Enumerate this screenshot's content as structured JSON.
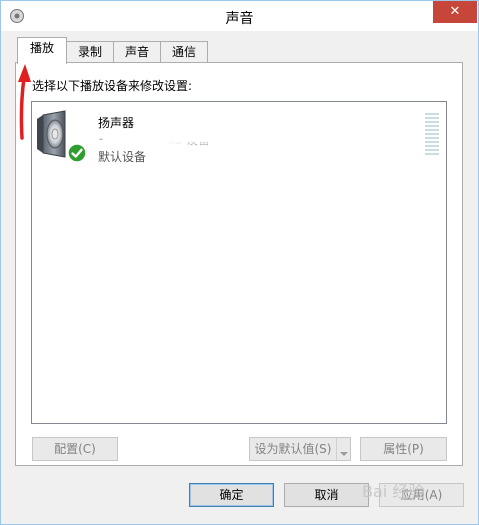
{
  "window": {
    "title": "声音",
    "close_glyph": "✕"
  },
  "tabs": [
    {
      "label": "播放",
      "active": true
    },
    {
      "label": "录制",
      "active": false
    },
    {
      "label": "声音",
      "active": false
    },
    {
      "label": "通信",
      "active": false
    }
  ],
  "playback": {
    "instruction": "选择以下播放设备来修改设置:",
    "devices": [
      {
        "name": "扬声器",
        "description_fragment_1": "⁃",
        "description_fragment_2": "lio",
        "description_fragment_3": "设备",
        "status": "默认设备",
        "icon": "speaker-icon",
        "badge": "green-check-icon"
      }
    ]
  },
  "buttons": {
    "configure": "配置(C)",
    "set_default": "设为默认值(S)",
    "properties": "属性(P)",
    "ok": "确定",
    "cancel": "取消",
    "apply": "应用(A)"
  },
  "watermark_text": "Bai 经验",
  "colors": {
    "close_button": "#c7463a",
    "accent_border": "#3c7fb1",
    "annotation_arrow": "#e02020",
    "check_badge": "#2e9e2e"
  }
}
